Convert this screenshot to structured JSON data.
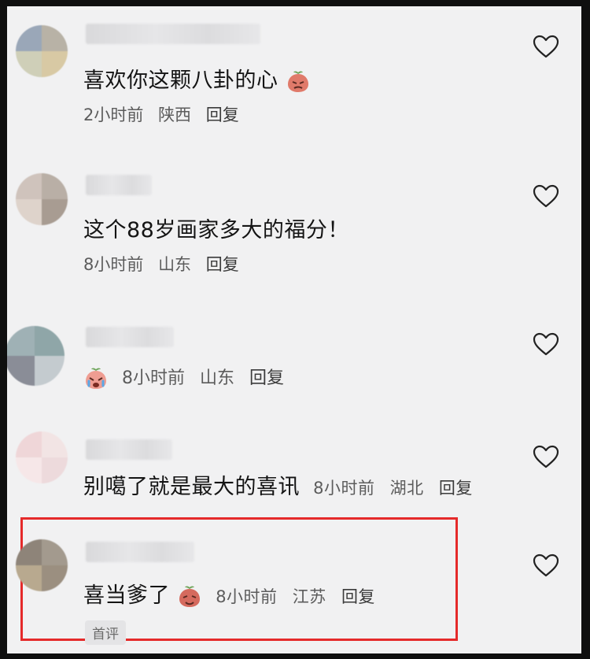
{
  "comments": [
    {
      "text": "喜欢你这颗八卦的心",
      "emoji": "peach-sneer",
      "time": "2小时前",
      "location": "陕西",
      "reply": "回复"
    },
    {
      "text": "这个88岁画家多大的福分！",
      "time": "8小时前",
      "location": "山东",
      "reply": "回复"
    },
    {
      "emoji": "crying-peach",
      "time": "8小时前",
      "location": "山东",
      "reply": "回复"
    },
    {
      "text": "别噶了就是最大的喜讯",
      "time": "8小时前",
      "location": "湖北",
      "reply": "回复"
    },
    {
      "text": "喜当爹了",
      "emoji": "smirking-peach",
      "time": "8小时前",
      "location": "江苏",
      "reply": "回复",
      "badge": "首评"
    }
  ],
  "colors": {
    "background": "#f1f1f2",
    "highlight": "#e52a2a",
    "emoji": "#d56a5e"
  },
  "icons": {
    "like": "heart-outline-icon"
  }
}
